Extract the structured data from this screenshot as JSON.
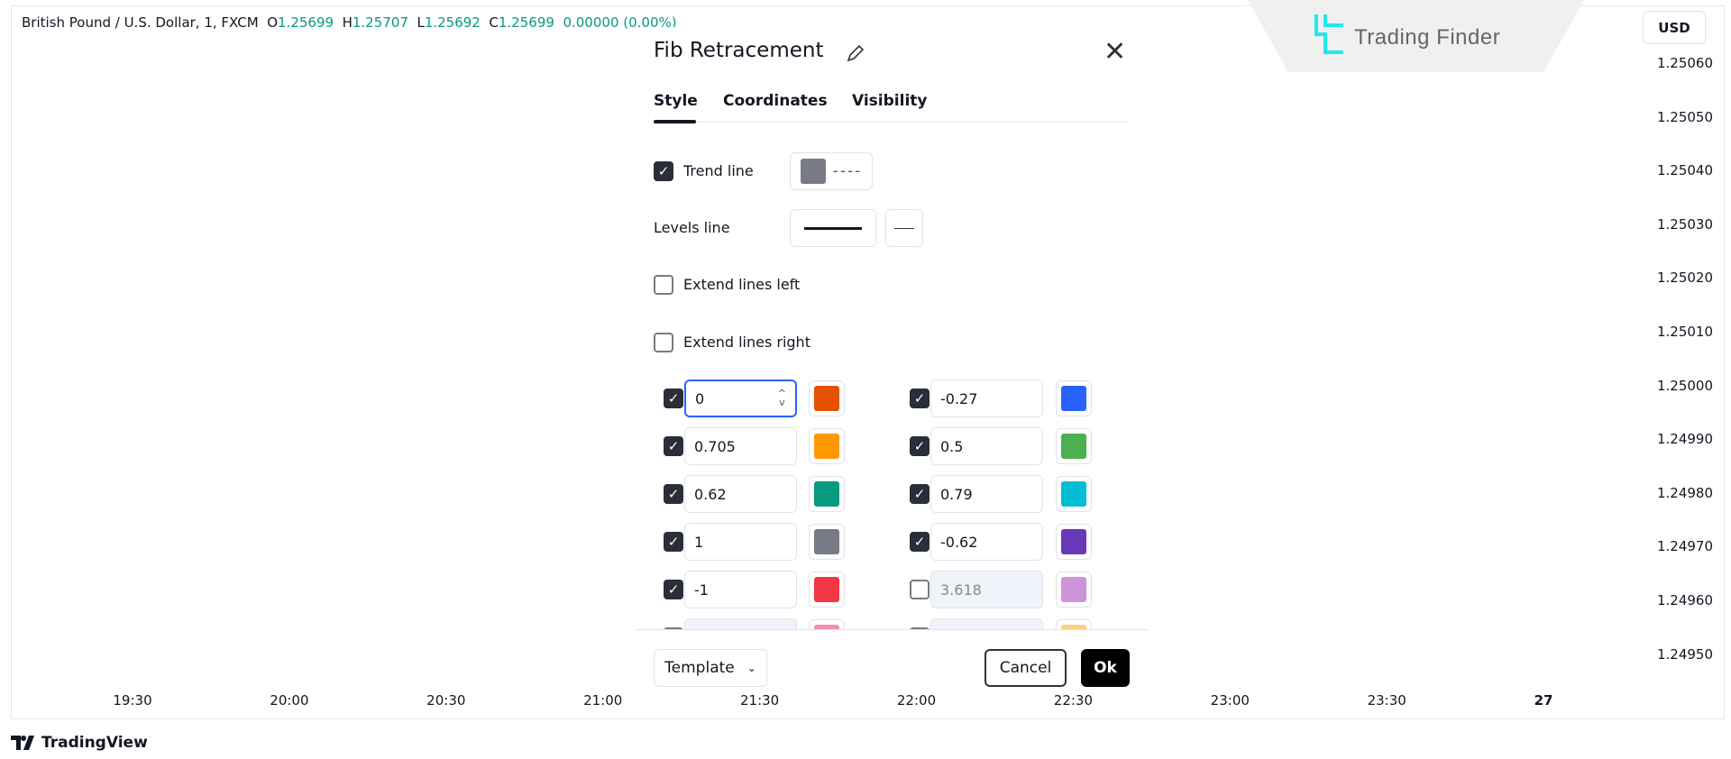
{
  "legend": {
    "symbol": "British Pound / U.S. Dollar, 1, FXCM",
    "o_label": "O",
    "o": "1.25699",
    "h_label": "H",
    "h": "1.25707",
    "l_label": "L",
    "l": "1.25692",
    "c_label": "C",
    "c": "1.25699",
    "change": "0.00000 (0.00%)"
  },
  "watermark": "Trading Finder",
  "currency": "USD",
  "price_axis": [
    "1.25060",
    "1.25050",
    "1.25040",
    "1.25030",
    "1.25020",
    "1.25010",
    "1.25000",
    "1.24990",
    "1.24980",
    "1.24970",
    "1.24960",
    "1.24950"
  ],
  "time_axis": [
    "19:30",
    "20:00",
    "20:30",
    "21:00",
    "21:30",
    "22:00",
    "22:30",
    "23:00",
    "23:30",
    "27"
  ],
  "branding": "TradingView",
  "dialog": {
    "title": "Fib Retracement",
    "tabs": [
      "Style",
      "Coordinates",
      "Visibility"
    ],
    "active_tab": "Style",
    "trend_line": {
      "label": "Trend line",
      "checked": true,
      "color": "#787b86"
    },
    "levels_line": {
      "label": "Levels line"
    },
    "extend_left": {
      "label": "Extend lines left",
      "checked": false
    },
    "extend_right": {
      "label": "Extend lines right",
      "checked": false
    },
    "levels_left": [
      {
        "value": "0",
        "checked": true,
        "color": "#e65100"
      },
      {
        "value": "0.705",
        "checked": true,
        "color": "#ff9800"
      },
      {
        "value": "0.62",
        "checked": true,
        "color": "#089981"
      },
      {
        "value": "1",
        "checked": true,
        "color": "#787b86"
      },
      {
        "value": "-1",
        "checked": true,
        "color": "#f23645"
      },
      {
        "value": "",
        "checked": false,
        "color": "#f48fb1"
      }
    ],
    "levels_right": [
      {
        "value": "-0.27",
        "checked": true,
        "color": "#2962ff"
      },
      {
        "value": "0.5",
        "checked": true,
        "color": "#4caf50"
      },
      {
        "value": "0.79",
        "checked": true,
        "color": "#00bcd4"
      },
      {
        "value": "-0.62",
        "checked": true,
        "color": "#673ab7"
      },
      {
        "value": "3.618",
        "checked": false,
        "color": "#ce93d8"
      },
      {
        "value": "",
        "checked": false,
        "color": "#ffcc80"
      }
    ],
    "template_label": "Template",
    "cancel_label": "Cancel",
    "ok_label": "Ok"
  }
}
